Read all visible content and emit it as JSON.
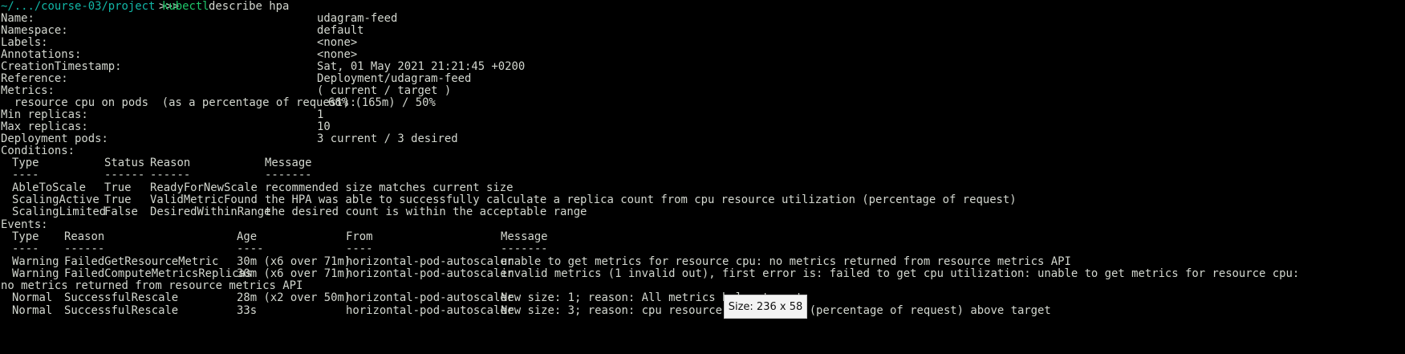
{
  "prompt": {
    "path": "~/.../course-03/project",
    "arrows": ">>>",
    "command": "kubectl",
    "args": "describe hpa"
  },
  "describe": {
    "name_key": "Name:",
    "name_val": "udagram-feed",
    "namespace_key": "Namespace:",
    "namespace_val": "default",
    "labels_key": "Labels:",
    "labels_val": "<none>",
    "annotations_key": "Annotations:",
    "annotations_val": "<none>",
    "creation_key": "CreationTimestamp:",
    "creation_val": "Sat, 01 May 2021 21:21:45 +0200",
    "reference_key": "Reference:",
    "reference_val": "Deployment/udagram-feed",
    "metrics_key": "Metrics:",
    "metrics_val": "( current / target )",
    "cpu_key": "  resource cpu on pods  (as a percentage of request):",
    "cpu_val": "66% (165m) / 50%",
    "min_key": "Min replicas:",
    "min_val": "1",
    "max_key": "Max replicas:",
    "max_val": "10",
    "pods_key": "Deployment pods:",
    "pods_val": "3 current / 3 desired"
  },
  "conditions": {
    "heading": "Conditions:",
    "headers": [
      "Type",
      "Status",
      "Reason",
      "Message"
    ],
    "dashes": [
      "----",
      "------",
      "------",
      "-------"
    ],
    "rows": [
      [
        "AbleToScale",
        "True",
        "ReadyForNewScale",
        "recommended size matches current size"
      ],
      [
        "ScalingActive",
        "True",
        "ValidMetricFound",
        "the HPA was able to successfully calculate a replica count from cpu resource utilization (percentage of request)"
      ],
      [
        "ScalingLimited",
        "False",
        "DesiredWithinRange",
        "the desired count is within the acceptable range"
      ]
    ]
  },
  "events": {
    "heading": "Events:",
    "headers": [
      "Type",
      "Reason",
      "Age",
      "From",
      "Message"
    ],
    "dashes": [
      "----",
      "------",
      "----",
      "----",
      "-------"
    ],
    "rows": [
      [
        "Warning",
        "FailedGetResourceMetric",
        "30m (x6 over 71m)",
        "horizontal-pod-autoscaler",
        "unable to get metrics for resource cpu: no metrics returned from resource metrics API"
      ],
      [
        "Warning",
        "FailedComputeMetricsReplicas",
        "30m (x6 over 71m)",
        "horizontal-pod-autoscaler",
        "invalid metrics (1 invalid out), first error is: failed to get cpu utilization: unable to get metrics for resource cpu:"
      ],
      [
        "Normal",
        "SuccessfulRescale",
        "28m (x2 over 50m)",
        "horizontal-pod-autoscaler",
        "New size: 1; reason: All metrics below target"
      ],
      [
        "Normal",
        "SuccessfulRescale",
        "33s",
        "horizontal-pod-autoscaler",
        "New size: 3; reason: cpu resource utilization (percentage of request) above target"
      ]
    ],
    "wrap_line": "no metrics returned from resource metrics API"
  },
  "tooltip": {
    "text": "Size: 236 x 58"
  },
  "colors": {
    "background": "#000000",
    "text": "#d3d7cf",
    "prompt_path": "#12b6a6",
    "prompt_command": "#1ec76a"
  }
}
